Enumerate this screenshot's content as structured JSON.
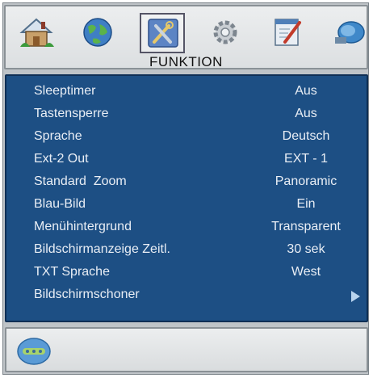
{
  "header": {
    "title": "FUNKTION",
    "icons": [
      "home-icon",
      "globe-icon",
      "tools-icon",
      "settings-gear-icon",
      "notepad-icon",
      "satellite-icon"
    ],
    "selected_icon": "tools-icon"
  },
  "menu": {
    "items": [
      {
        "label": "Sleeptimer",
        "value": "Aus"
      },
      {
        "label": "Tastensperre",
        "value": "Aus"
      },
      {
        "label": "Sprache",
        "value": "Deutsch"
      },
      {
        "label": "Ext-2 Out",
        "value": "EXT - 1"
      },
      {
        "label": "Standard  Zoom",
        "value": "Panoramic"
      },
      {
        "label": "Blau-Bild",
        "value": "Ein"
      },
      {
        "label": "Menühintergrund",
        "value": "Transparent"
      },
      {
        "label": "Bildschirmanzeige Zeitl.",
        "value": "30 sek"
      },
      {
        "label": "TXT Sprache",
        "value": "West"
      },
      {
        "label": "Bildschirmschoner",
        "value": ""
      }
    ]
  },
  "footer": {
    "icon": "remote-control-icon"
  },
  "colors": {
    "menu_background": "#1d4f84",
    "menu_text": "#e9eef5",
    "panel_background": "#dcdfe1"
  }
}
